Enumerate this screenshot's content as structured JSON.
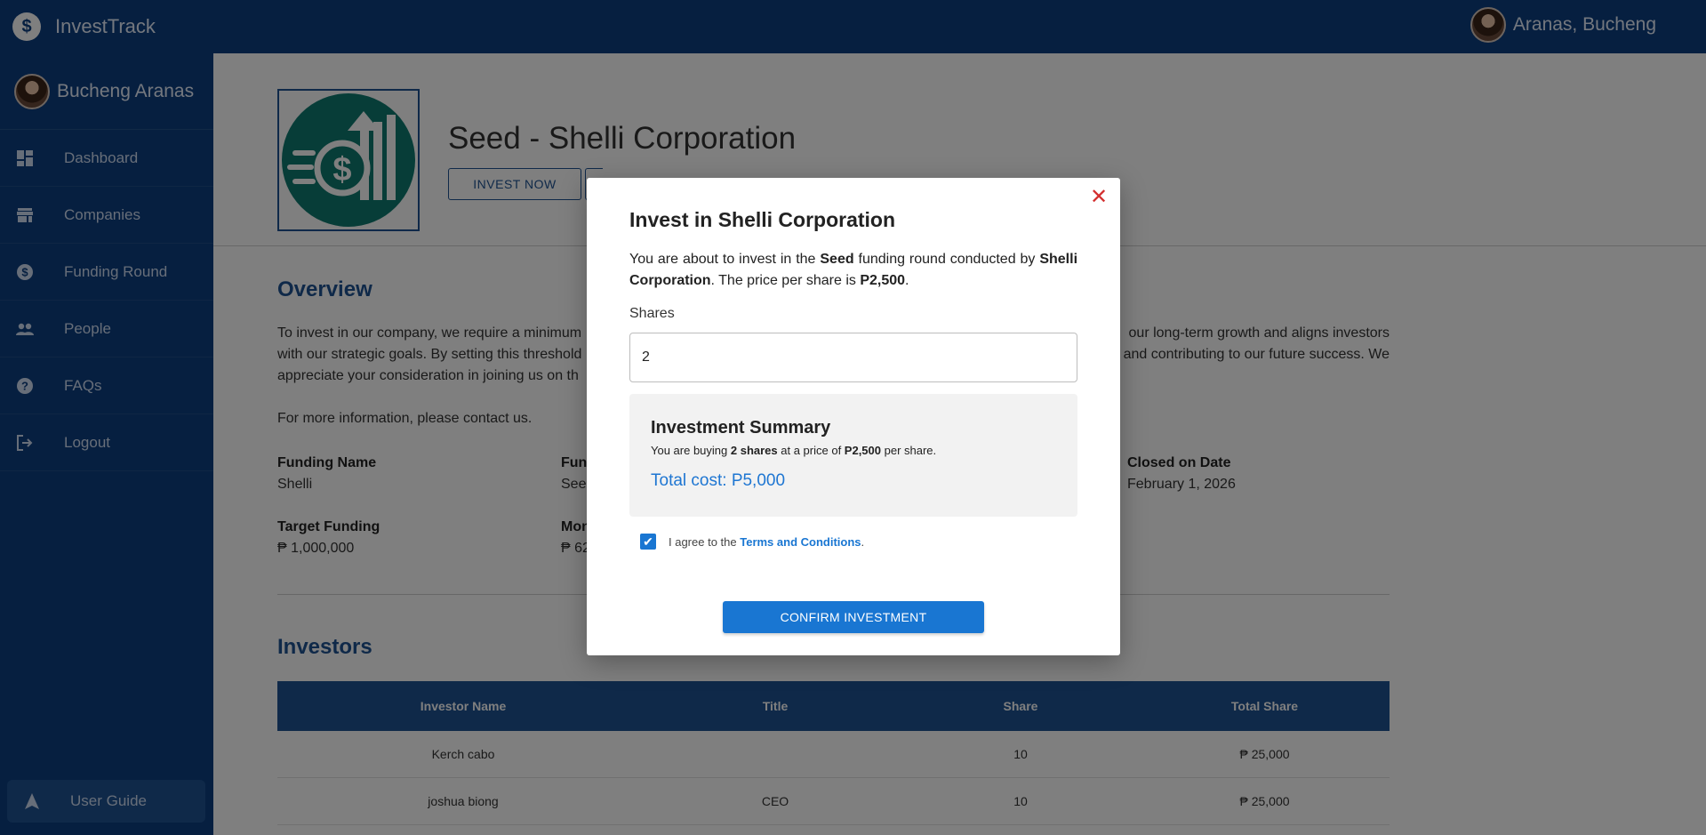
{
  "app": {
    "name": "InvestTrack"
  },
  "topbar": {
    "user_name": "Aranas, Bucheng"
  },
  "sidebar": {
    "profile_name": "Bucheng Aranas",
    "items": [
      {
        "label": "Dashboard",
        "icon": "dashboard-icon"
      },
      {
        "label": "Companies",
        "icon": "store-icon"
      },
      {
        "label": "Funding Round",
        "icon": "dollar-icon"
      },
      {
        "label": "People",
        "icon": "people-icon"
      },
      {
        "label": "FAQs",
        "icon": "help-icon"
      },
      {
        "label": "Logout",
        "icon": "logout-icon"
      }
    ],
    "user_guide": "User Guide"
  },
  "page": {
    "title": "Seed - Shelli Corporation",
    "invest_button": "INVEST NOW",
    "overview_title": "Overview",
    "overview_text_left": "To invest in our company, we require a minimum",
    "overview_text_right": "our long-term growth and aligns investors",
    "overview_text_line2_left": "with our strategic goals. By setting this threshold",
    "overview_text_line2_right": "and contributing to our future success. We",
    "overview_text_line3": "appreciate your consideration in joining us on th",
    "overview_more": "For more information, please contact us.",
    "fields": {
      "funding_name_label": "Funding Name",
      "funding_name_value": "Shelli",
      "funding_type_label": "Fun",
      "funding_type_value": "See",
      "closed_label": "Closed on Date",
      "closed_value": "February 1, 2026",
      "target_label": "Target Funding",
      "target_value": "₱ 1,000,000",
      "money_label": "Mon",
      "money_value": "₱ 62"
    },
    "investors_title": "Investors",
    "table": {
      "headers": [
        "Investor Name",
        "Title",
        "Share",
        "Total Share"
      ],
      "rows": [
        {
          "name": "Kerch cabo",
          "title": "",
          "share": "10",
          "total": "₱ 25,000"
        },
        {
          "name": "joshua biong",
          "title": "CEO",
          "share": "10",
          "total": "₱ 25,000"
        }
      ]
    }
  },
  "modal": {
    "title": "Invest in Shelli Corporation",
    "desc_1": "You are about to invest in the ",
    "desc_round": "Seed",
    "desc_2": " funding round conducted by ",
    "desc_company": "Shelli Corporation",
    "desc_3": ". The price per share is ",
    "desc_price": "P2,500",
    "desc_4": ".",
    "shares_label": "Shares",
    "shares_value": "2",
    "summary_title": "Investment Summary",
    "summary_1": "You are buying ",
    "summary_shares": "2 shares",
    "summary_2": " at a price of ",
    "summary_price": "P2,500",
    "summary_3": " per share.",
    "total_cost": "Total cost: P5,000",
    "agree_text": "I agree to the ",
    "terms_link": "Terms and Conditions",
    "agree_end": ".",
    "agree_checked": true,
    "confirm_button": "CONFIRM INVESTMENT"
  },
  "colors": {
    "sidebar_bg": "#0d3f80",
    "accent": "#1e5393",
    "primary_button": "#1976d2",
    "close_icon": "#d32f2f"
  }
}
